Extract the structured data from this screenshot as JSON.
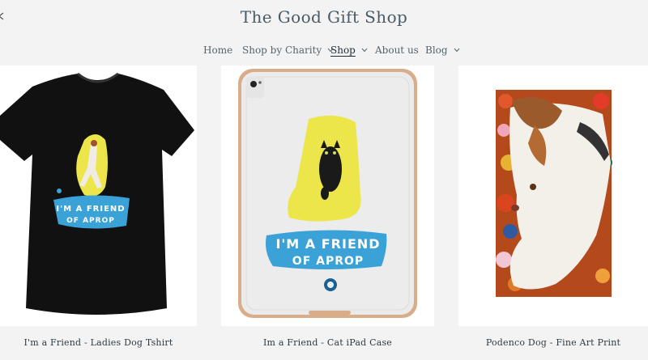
{
  "site": {
    "title": "The Good Gift Shop"
  },
  "nav": {
    "items": [
      {
        "label": "Home",
        "dropdown": false,
        "active": false
      },
      {
        "label": "Shop by Charity",
        "dropdown": true,
        "active": false
      },
      {
        "label": "Shop",
        "dropdown": true,
        "active": true
      },
      {
        "label": "About us",
        "dropdown": false,
        "active": false
      },
      {
        "label": "Blog",
        "dropdown": true,
        "active": false
      }
    ]
  },
  "products": [
    {
      "title": "I'm a Friend - Ladies Dog Tshirt",
      "print_text_line1": "I'M A FRIEND",
      "print_text_line2": "OF APROP",
      "image_icon": "tshirt-icon"
    },
    {
      "title": "Im a Friend - Cat iPad Case",
      "print_text_line1": "I'M A FRIEND",
      "print_text_line2": "OF APROP",
      "image_icon": "ipad-case-icon"
    },
    {
      "title": "Podenco Dog - Fine Art Print",
      "image_icon": "art-print-icon"
    }
  ],
  "colors": {
    "background": "#f3f3f3",
    "text": "#3a4b57",
    "brush_yellow": "#ece64a",
    "brush_blue": "#3aa2d6",
    "shirt": "#111111"
  }
}
